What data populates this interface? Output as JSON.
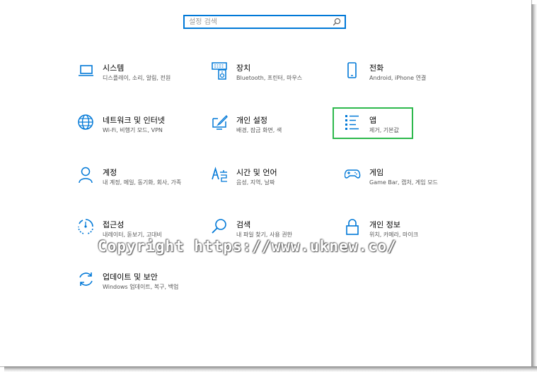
{
  "search": {
    "placeholder": "설정 검색",
    "value": ""
  },
  "tiles": [
    {
      "title": "시스템",
      "subtitle": "디스플레이, 소리, 알림, 전원",
      "icon": "laptop-icon"
    },
    {
      "title": "장치",
      "subtitle": "Bluetooth, 프린터, 마우스",
      "icon": "keyboard-speaker-icon"
    },
    {
      "title": "전화",
      "subtitle": "Android, iPhone 연결",
      "icon": "phone-icon"
    },
    {
      "title": "네트워크 및 인터넷",
      "subtitle": "Wi-Fi, 비행기 모드, VPN",
      "icon": "globe-icon"
    },
    {
      "title": "개인 설정",
      "subtitle": "배경, 잠금 화면, 색",
      "icon": "paint-monitor-icon"
    },
    {
      "title": "앱",
      "subtitle": "제거, 기본값",
      "icon": "apps-list-icon"
    },
    {
      "title": "계정",
      "subtitle": "내 계정, 메일, 동기화, 회사, 가족",
      "icon": "person-icon"
    },
    {
      "title": "시간 및 언어",
      "subtitle": "음성, 지역, 날짜",
      "icon": "time-language-icon"
    },
    {
      "title": "게임",
      "subtitle": "Game Bar, 캡처, 게임 모드",
      "icon": "gamepad-icon"
    },
    {
      "title": "접근성",
      "subtitle": "내레이터, 돋보기, 고대비",
      "icon": "accessibility-icon"
    },
    {
      "title": "검색",
      "subtitle": "내 파일 찾기, 사용 권한",
      "icon": "search-icon"
    },
    {
      "title": "개인 정보",
      "subtitle": "위치, 카메라, 마이크",
      "icon": "lock-icon"
    },
    {
      "title": "업데이트 및 보안",
      "subtitle": "Windows 업데이트, 복구, 백업",
      "icon": "sync-icon"
    }
  ],
  "watermark": "Copyright  https://www.uknew.co/",
  "colors": {
    "accent": "#0078d7",
    "highlight": "#2db84c"
  }
}
